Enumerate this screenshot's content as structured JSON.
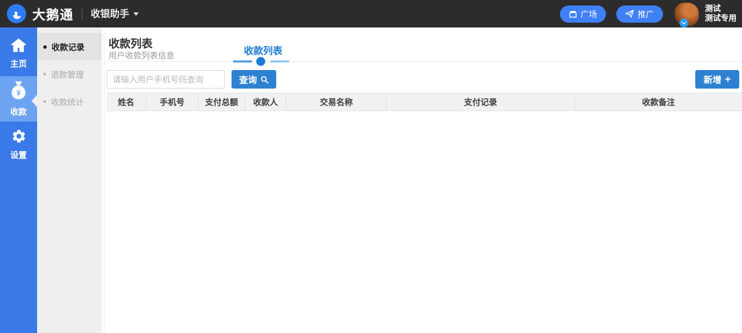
{
  "topbar": {
    "brand": "大鹅通",
    "app_name": "收银助手",
    "plaza_button": "广场",
    "promote_button": "推广",
    "user": {
      "name": "测试",
      "role": "测试专用"
    }
  },
  "sidebar": {
    "items": [
      {
        "label": "主页",
        "icon": "home-icon",
        "selected": false
      },
      {
        "label": "收款",
        "icon": "moneybag-yen-icon",
        "selected": true
      },
      {
        "label": "设置",
        "icon": "gear-icon",
        "selected": false
      }
    ]
  },
  "submenu": {
    "items": [
      {
        "label": "收款记录",
        "selected": true
      },
      {
        "label": "退款管理",
        "selected": false
      },
      {
        "label": "收款统计",
        "selected": false
      }
    ]
  },
  "main": {
    "title": "收款列表",
    "subtitle": "用户收款列表信息",
    "tab": "收款列表",
    "search": {
      "placeholder": "请输入用户手机号码查询",
      "button": "查询"
    },
    "add_button": {
      "label": "新增",
      "plus": "+"
    },
    "table": {
      "columns": [
        "姓名",
        "手机号",
        "支付总额",
        "收款人",
        "交易名称",
        "支付记录",
        "收款备注"
      ],
      "rows": []
    }
  },
  "icons": {
    "logo": "swan-icon",
    "app_caret": "chevron-down-icon",
    "plaza": "storefront-icon",
    "promote": "paper-plane-icon",
    "avatar_badge": "chevron-down-icon",
    "nav_home": "home-icon",
    "nav_collect": "moneybag-yen-icon",
    "moneybag_currency": "¥",
    "nav_settings": "gear-icon",
    "search": "magnifier-icon"
  },
  "colors": {
    "topbar_bg": "#2c2c2c",
    "brand_logo_blue": "#2e7cf2",
    "topbar_button_blue": "#3f80f6",
    "nav_bg": "#3a7ae8",
    "nav_selected_bg": "#6da4f2",
    "submenu_bg": "#efefef",
    "submenu_selected_bg": "#e3e3e3",
    "accent_button_blue": "#2e81d0",
    "tab_blue": "#1b7cd6",
    "table_header_bg": "#f1f1f1"
  }
}
